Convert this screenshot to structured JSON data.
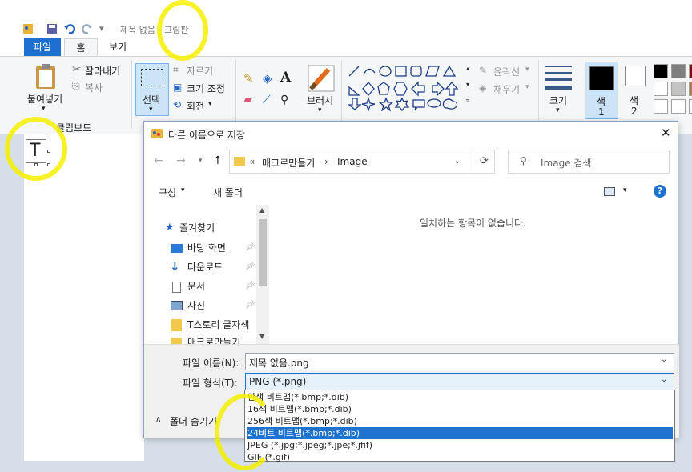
{
  "window": {
    "title": "제목 없음 - 그림판"
  },
  "tabs": [
    "파일",
    "홈",
    "보기"
  ],
  "ribbon": {
    "paste": "붙여넣기",
    "cut": "잘라내기",
    "copy": "복사",
    "clipboard_group": "클립보드",
    "select": "선택",
    "crop": "자르기",
    "resize": "크기 조정",
    "rotate": "회전",
    "brushes": "브러시",
    "outline": "윤곽선",
    "fill": "채우기",
    "size": "크기",
    "color1": "색\n1",
    "color1_a": "색",
    "color1_b": "1",
    "color2_a": "색",
    "color2_b": "2"
  },
  "canvas": {
    "text_tool_glyph": "T"
  },
  "dialog": {
    "title": "다른 이름으로 저장",
    "close": "✕",
    "breadcrumb": [
      "매크로만들기",
      "Image"
    ],
    "breadcrumb_prefix": "«",
    "search_placeholder": "Image 검색",
    "organize": "구성",
    "new_folder": "새 폴더",
    "help": "?",
    "empty_message": "일치하는 항목이 없습니다.",
    "nav": {
      "quick_access": "즐겨찾기",
      "items": [
        "바탕 화면",
        "다운로드",
        "문서",
        "사진",
        "T스토리 글자색",
        "매크로만들기"
      ]
    },
    "filename_label": "파일 이름(N):",
    "filename_value": "제목 없음.png",
    "filetype_label": "파일 형식(T):",
    "filetype_value": "PNG (*.png)",
    "hide_folders": "폴더 숨기기",
    "filetype_options": [
      "단색 비트맵(*.bmp;*.dib)",
      "16색 비트맵(*.bmp;*.dib)",
      "256색 비트맵(*.bmp;*.dib)",
      "24비트 비트맵(*.bmp;*.dib)",
      "JPEG (*.jpg;*.jpeg;*.jpe;*.jfif)",
      "GIF (*.gif)"
    ],
    "selected_option_index": 3
  },
  "colors": {
    "accent": "#1e73d1",
    "highlight": "#f4f000"
  }
}
